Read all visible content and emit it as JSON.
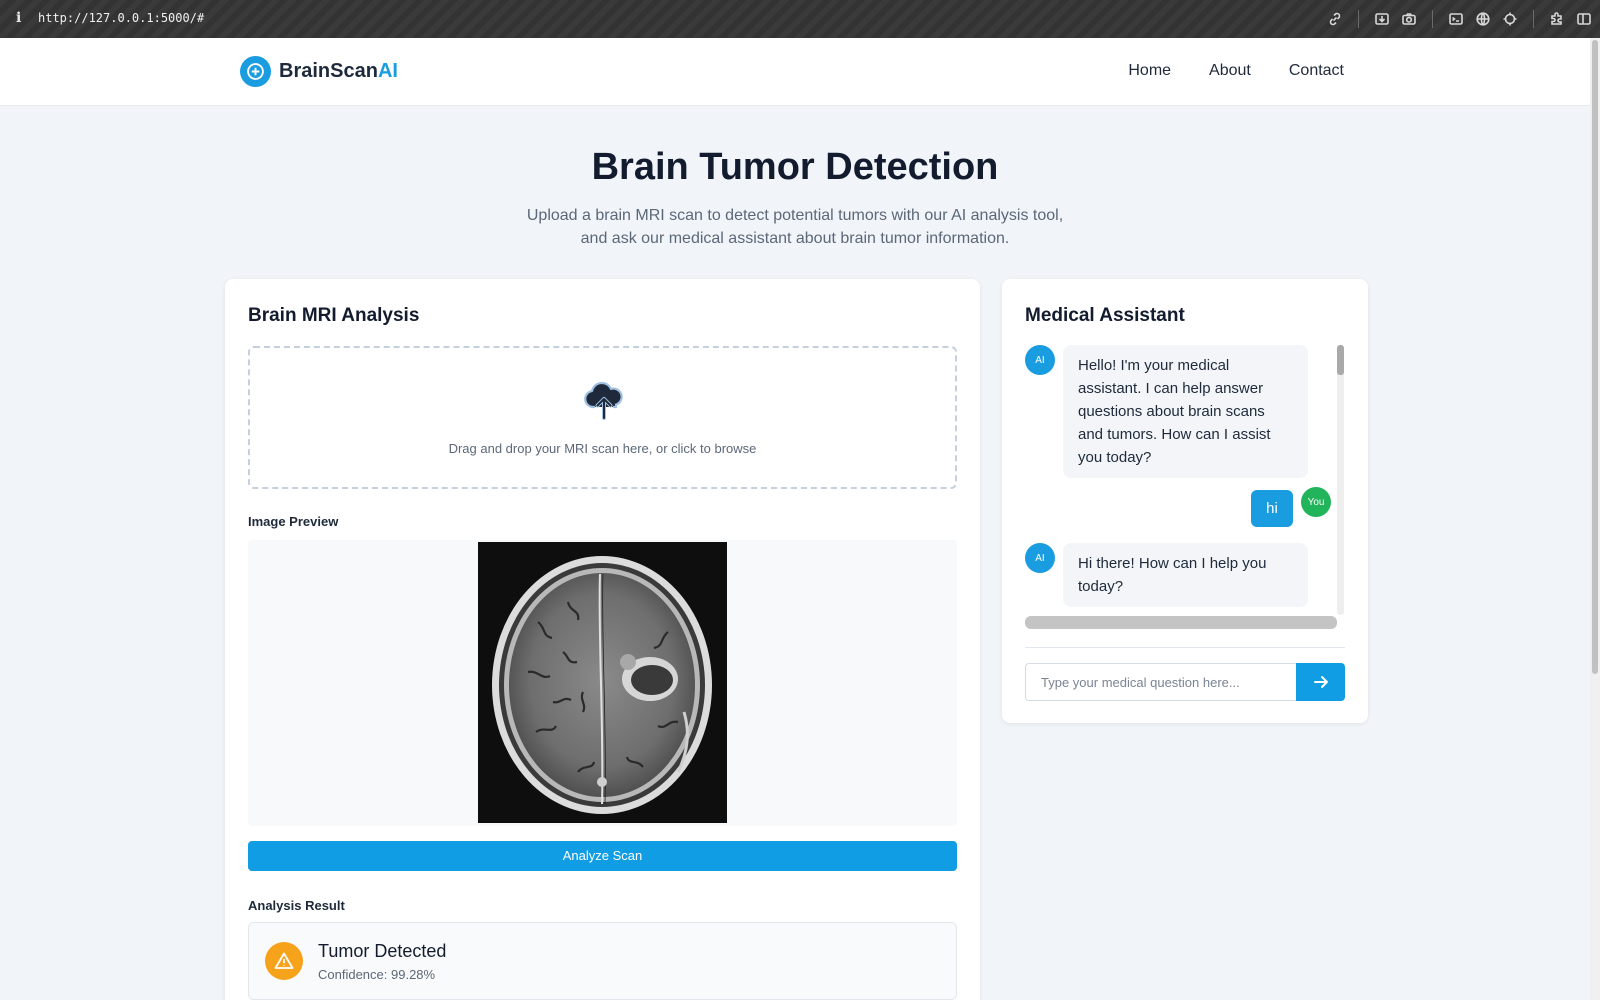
{
  "browser": {
    "info_glyph": "i",
    "url": "http://127.0.0.1:5000/#",
    "tool_icons": [
      "link-icon",
      "download-icon",
      "camera-icon",
      "terminal-icon",
      "globe-icon",
      "crosshair-icon",
      "extension-icon",
      "sidebar-icon"
    ]
  },
  "nav": {
    "brand_main": "BrainScan",
    "brand_accent": "AI",
    "links": [
      "Home",
      "About",
      "Contact"
    ]
  },
  "hero": {
    "title": "Brain Tumor Detection",
    "subtitle_line1": "Upload a brain MRI scan to detect potential tumors with our AI analysis tool,",
    "subtitle_line2": "and ask our medical assistant about brain tumor information."
  },
  "analysis": {
    "title": "Brain MRI Analysis",
    "dropzone_text": "Drag and drop your MRI scan here, or click to browse",
    "preview_label": "Image Preview",
    "analyze_button": "Analyze Scan",
    "result_label": "Analysis Result",
    "result_title": "Tumor Detected",
    "result_confidence": "Confidence: 99.28%"
  },
  "chat": {
    "title": "Medical Assistant",
    "ai_avatar": "AI",
    "user_avatar": "You",
    "messages": [
      {
        "sender": "AI",
        "lines": [
          "Hello! I'm your medical",
          "assistant. I can help answer",
          "questions about brain scans",
          "and tumors. How can I assist",
          "you today?"
        ]
      },
      {
        "sender": "You",
        "text": "hi"
      },
      {
        "sender": "AI",
        "lines": [
          "Hi there! How can I help you",
          "today?"
        ]
      }
    ],
    "input_placeholder": "Type your medical question here..."
  },
  "colors": {
    "accent": "#1a9ce0",
    "button": "#109de4",
    "user_avatar": "#22b45a",
    "warning": "#f7a21b",
    "page_bg": "#f1f4f8"
  }
}
